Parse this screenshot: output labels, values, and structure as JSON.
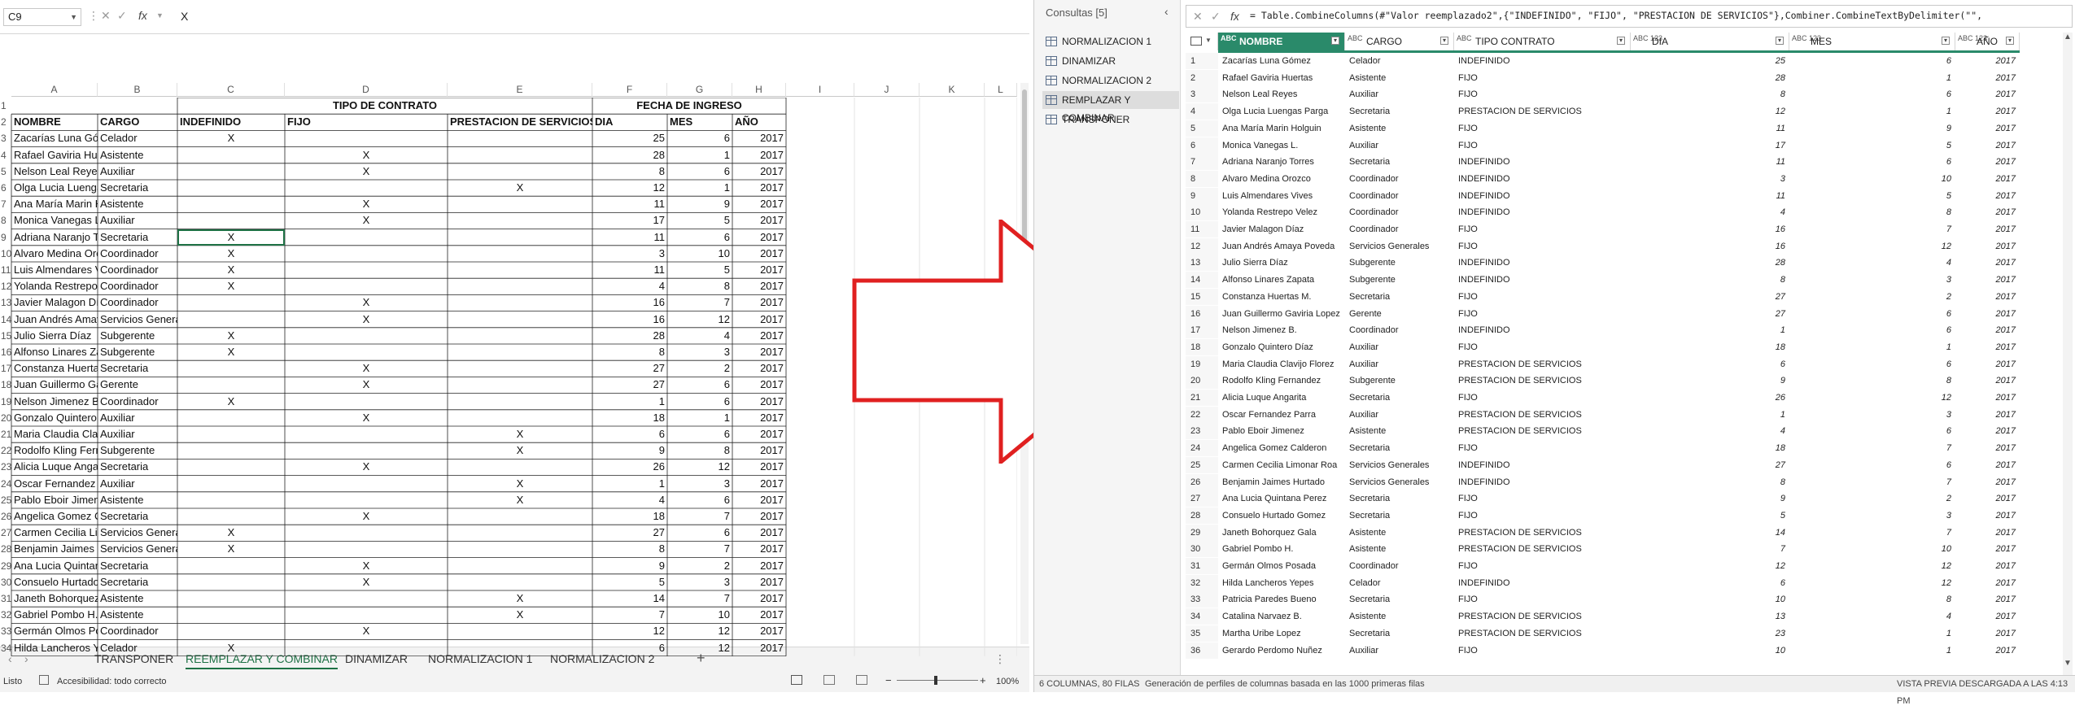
{
  "excel": {
    "name_box": "C9",
    "formula_value": "X",
    "columns": [
      "A",
      "B",
      "C",
      "D",
      "E",
      "F",
      "G",
      "H",
      "I",
      "J",
      "K",
      "L"
    ],
    "header_row1": {
      "tipo_contrato": "TIPO DE CONTRATO",
      "fecha_ingreso": "FECHA DE INGRESO"
    },
    "header_row2": [
      "NOMBRE",
      "CARGO",
      "INDEFINIDO",
      "FIJO",
      "PRESTACION DE SERVICIOS",
      "DIA",
      "MES",
      "AÑO"
    ],
    "rows": [
      [
        "Zacarías Luna Gómez",
        "Celador",
        "X",
        "",
        "",
        "25",
        "6",
        "2017"
      ],
      [
        "Rafael Gaviria Huertas",
        "Asistente",
        "",
        "X",
        "",
        "28",
        "1",
        "2017"
      ],
      [
        "Nelson Leal Reyes",
        "Auxiliar",
        "",
        "X",
        "",
        "8",
        "6",
        "2017"
      ],
      [
        "Olga Lucia Luengas Parga",
        "Secretaria",
        "",
        "",
        "X",
        "12",
        "1",
        "2017"
      ],
      [
        "Ana María Marin Holguin",
        "Asistente",
        "",
        "X",
        "",
        "11",
        "9",
        "2017"
      ],
      [
        "Monica Vanegas L.",
        "Auxiliar",
        "",
        "X",
        "",
        "17",
        "5",
        "2017"
      ],
      [
        "Adriana Naranjo Torres",
        "Secretaria",
        "X",
        "",
        "",
        "11",
        "6",
        "2017"
      ],
      [
        "Alvaro Medina Orozco",
        "Coordinador",
        "X",
        "",
        "",
        "3",
        "10",
        "2017"
      ],
      [
        "Luis Almendares Vives",
        "Coordinador",
        "X",
        "",
        "",
        "11",
        "5",
        "2017"
      ],
      [
        "Yolanda Restrepo Velez",
        "Coordinador",
        "X",
        "",
        "",
        "4",
        "8",
        "2017"
      ],
      [
        "Javier Malagon Díaz",
        "Coordinador",
        "",
        "X",
        "",
        "16",
        "7",
        "2017"
      ],
      [
        "Juan Andrés Amaya Poveda",
        "Servicios Generales",
        "",
        "X",
        "",
        "16",
        "12",
        "2017"
      ],
      [
        "Julio Sierra Díaz",
        "Subgerente",
        "X",
        "",
        "",
        "28",
        "4",
        "2017"
      ],
      [
        "Alfonso Linares Zapata",
        "Subgerente",
        "X",
        "",
        "",
        "8",
        "3",
        "2017"
      ],
      [
        "Constanza Huertas M.",
        "Secretaria",
        "",
        "X",
        "",
        "27",
        "2",
        "2017"
      ],
      [
        "Juan Guillermo Gaviria Lopez",
        "Gerente",
        "",
        "X",
        "",
        "27",
        "6",
        "2017"
      ],
      [
        "Nelson Jimenez B.",
        "Coordinador",
        "X",
        "",
        "",
        "1",
        "6",
        "2017"
      ],
      [
        "Gonzalo Quintero Díaz",
        "Auxiliar",
        "",
        "X",
        "",
        "18",
        "1",
        "2017"
      ],
      [
        "Maria Claudia Clavijo Florez",
        "Auxiliar",
        "",
        "",
        "X",
        "6",
        "6",
        "2017"
      ],
      [
        "Rodolfo Kling Fernandez",
        "Subgerente",
        "",
        "",
        "X",
        "9",
        "8",
        "2017"
      ],
      [
        "Alicia Luque Angarita",
        "Secretaria",
        "",
        "X",
        "",
        "26",
        "12",
        "2017"
      ],
      [
        "Oscar Fernandez Parra",
        "Auxiliar",
        "",
        "",
        "X",
        "1",
        "3",
        "2017"
      ],
      [
        "Pablo Eboir Jimenez",
        "Asistente",
        "",
        "",
        "X",
        "4",
        "6",
        "2017"
      ],
      [
        "Angelica Gomez Calderon",
        "Secretaria",
        "",
        "X",
        "",
        "18",
        "7",
        "2017"
      ],
      [
        "Carmen Cecilia Limonar Roa",
        "Servicios Generales",
        "X",
        "",
        "",
        "27",
        "6",
        "2017"
      ],
      [
        "Benjamin Jaimes Hurtado",
        "Servicios Generales",
        "X",
        "",
        "",
        "8",
        "7",
        "2017"
      ],
      [
        "Ana Lucia Quintana Perez",
        "Secretaria",
        "",
        "X",
        "",
        "9",
        "2",
        "2017"
      ],
      [
        "Consuelo Hurtado Gomez",
        "Secretaria",
        "",
        "X",
        "",
        "5",
        "3",
        "2017"
      ],
      [
        "Janeth Bohorquez Gala",
        "Asistente",
        "",
        "",
        "X",
        "14",
        "7",
        "2017"
      ],
      [
        "Gabriel Pombo H.",
        "Asistente",
        "",
        "",
        "X",
        "7",
        "10",
        "2017"
      ],
      [
        "Germán Olmos Posada",
        "Coordinador",
        "",
        "X",
        "",
        "12",
        "12",
        "2017"
      ],
      [
        "Hilda Lancheros Yepes",
        "Celador",
        "X",
        "",
        "",
        "6",
        "12",
        "2017"
      ]
    ],
    "sheet_tabs": [
      "TRANSPONER",
      "REEMPLAZAR Y COMBINAR",
      "DINAMIZAR",
      "NORMALIZACION 1",
      "NORMALIZACION 2"
    ],
    "active_tab": "REEMPLAZAR Y COMBINAR",
    "status_ready": "Listo",
    "status_accessibility": "Accesibilidad: todo correcto",
    "zoom": "100%"
  },
  "pq": {
    "queries_title": "Consultas [5]",
    "queries": [
      "NORMALIZACION 1",
      "DINAMIZAR",
      "NORMALIZACION 2",
      "REMPLAZAR Y COMBINAR",
      "TRANSPONER"
    ],
    "selected_query": "REMPLAZAR Y COMBINAR",
    "formula": "= Table.CombineColumns(#\"Valor reemplazado2\",{\"INDEFINIDO\", \"FIJO\", \"PRESTACION DE SERVICIOS\"},Combiner.CombineTextByDelimiter(\"\",",
    "headers": [
      {
        "type": "ABC",
        "label": "NOMBRE"
      },
      {
        "type": "ABC",
        "label": "CARGO"
      },
      {
        "type": "ABC",
        "label": "TIPO CONTRATO"
      },
      {
        "type": "ABC 123",
        "label": "DIA"
      },
      {
        "type": "ABC 123",
        "label": "MES"
      },
      {
        "type": "ABC 123",
        "label": "AÑO"
      }
    ],
    "rows": [
      [
        "Zacarías Luna Gómez",
        "Celador",
        "INDEFINIDO",
        "25",
        "6",
        "2017"
      ],
      [
        "Rafael Gaviria Huertas",
        "Asistente",
        "FIJO",
        "28",
        "1",
        "2017"
      ],
      [
        "Nelson Leal Reyes",
        "Auxiliar",
        "FIJO",
        "8",
        "6",
        "2017"
      ],
      [
        "Olga Lucia Luengas Parga",
        "Secretaria",
        "PRESTACION DE SERVICIOS",
        "12",
        "1",
        "2017"
      ],
      [
        "Ana María Marin Holguin",
        "Asistente",
        "FIJO",
        "11",
        "9",
        "2017"
      ],
      [
        "Monica Vanegas L.",
        "Auxiliar",
        "FIJO",
        "17",
        "5",
        "2017"
      ],
      [
        "Adriana Naranjo Torres",
        "Secretaria",
        "INDEFINIDO",
        "11",
        "6",
        "2017"
      ],
      [
        "Alvaro Medina Orozco",
        "Coordinador",
        "INDEFINIDO",
        "3",
        "10",
        "2017"
      ],
      [
        "Luis Almendares Vives",
        "Coordinador",
        "INDEFINIDO",
        "11",
        "5",
        "2017"
      ],
      [
        "Yolanda Restrepo Velez",
        "Coordinador",
        "INDEFINIDO",
        "4",
        "8",
        "2017"
      ],
      [
        "Javier Malagon Díaz",
        "Coordinador",
        "FIJO",
        "16",
        "7",
        "2017"
      ],
      [
        "Juan Andrés Amaya Poveda",
        "Servicios Generales",
        "FIJO",
        "16",
        "12",
        "2017"
      ],
      [
        "Julio Sierra Díaz",
        "Subgerente",
        "INDEFINIDO",
        "28",
        "4",
        "2017"
      ],
      [
        "Alfonso Linares Zapata",
        "Subgerente",
        "INDEFINIDO",
        "8",
        "3",
        "2017"
      ],
      [
        "Constanza Huertas M.",
        "Secretaria",
        "FIJO",
        "27",
        "2",
        "2017"
      ],
      [
        "Juan Guillermo Gaviria Lopez",
        "Gerente",
        "FIJO",
        "27",
        "6",
        "2017"
      ],
      [
        "Nelson Jimenez B.",
        "Coordinador",
        "INDEFINIDO",
        "1",
        "6",
        "2017"
      ],
      [
        "Gonzalo Quintero Díaz",
        "Auxiliar",
        "FIJO",
        "18",
        "1",
        "2017"
      ],
      [
        "Maria Claudia Clavijo Florez",
        "Auxiliar",
        "PRESTACION DE SERVICIOS",
        "6",
        "6",
        "2017"
      ],
      [
        "Rodolfo Kling Fernandez",
        "Subgerente",
        "PRESTACION DE SERVICIOS",
        "9",
        "8",
        "2017"
      ],
      [
        "Alicia Luque Angarita",
        "Secretaria",
        "FIJO",
        "26",
        "12",
        "2017"
      ],
      [
        "Oscar Fernandez Parra",
        "Auxiliar",
        "PRESTACION DE SERVICIOS",
        "1",
        "3",
        "2017"
      ],
      [
        "Pablo Eboir Jimenez",
        "Asistente",
        "PRESTACION DE SERVICIOS",
        "4",
        "6",
        "2017"
      ],
      [
        "Angelica Gomez Calderon",
        "Secretaria",
        "FIJO",
        "18",
        "7",
        "2017"
      ],
      [
        "Carmen Cecilia Limonar Roa",
        "Servicios Generales",
        "INDEFINIDO",
        "27",
        "6",
        "2017"
      ],
      [
        "Benjamin Jaimes Hurtado",
        "Servicios Generales",
        "INDEFINIDO",
        "8",
        "7",
        "2017"
      ],
      [
        "Ana Lucia Quintana Perez",
        "Secretaria",
        "FIJO",
        "9",
        "2",
        "2017"
      ],
      [
        "Consuelo Hurtado Gomez",
        "Secretaria",
        "FIJO",
        "5",
        "3",
        "2017"
      ],
      [
        "Janeth Bohorquez Gala",
        "Asistente",
        "PRESTACION DE SERVICIOS",
        "14",
        "7",
        "2017"
      ],
      [
        "Gabriel Pombo H.",
        "Asistente",
        "PRESTACION DE SERVICIOS",
        "7",
        "10",
        "2017"
      ],
      [
        "Germán Olmos Posada",
        "Coordinador",
        "FIJO",
        "12",
        "12",
        "2017"
      ],
      [
        "Hilda Lancheros Yepes",
        "Celador",
        "INDEFINIDO",
        "6",
        "12",
        "2017"
      ],
      [
        "Patricia Paredes Bueno",
        "Secretaria",
        "FIJO",
        "10",
        "8",
        "2017"
      ],
      [
        "Catalina Narvaez B.",
        "Asistente",
        "PRESTACION DE SERVICIOS",
        "13",
        "4",
        "2017"
      ],
      [
        "Martha Uribe Lopez",
        "Secretaria",
        "PRESTACION DE SERVICIOS",
        "23",
        "1",
        "2017"
      ],
      [
        "Gerardo Perdomo Nuñez",
        "Auxiliar",
        "FIJO",
        "10",
        "1",
        "2017"
      ]
    ],
    "status_left": "6 COLUMNAS, 80 FILAS",
    "status_mid": "Generación de perfiles de columnas basada en las 1000 primeras filas",
    "status_right": "VISTA PREVIA DESCARGADA A LAS 4:13 PM"
  },
  "colors": {
    "accent": "#2a8a6a",
    "excel_green": "#1e7145",
    "arrow": "#e02020"
  }
}
